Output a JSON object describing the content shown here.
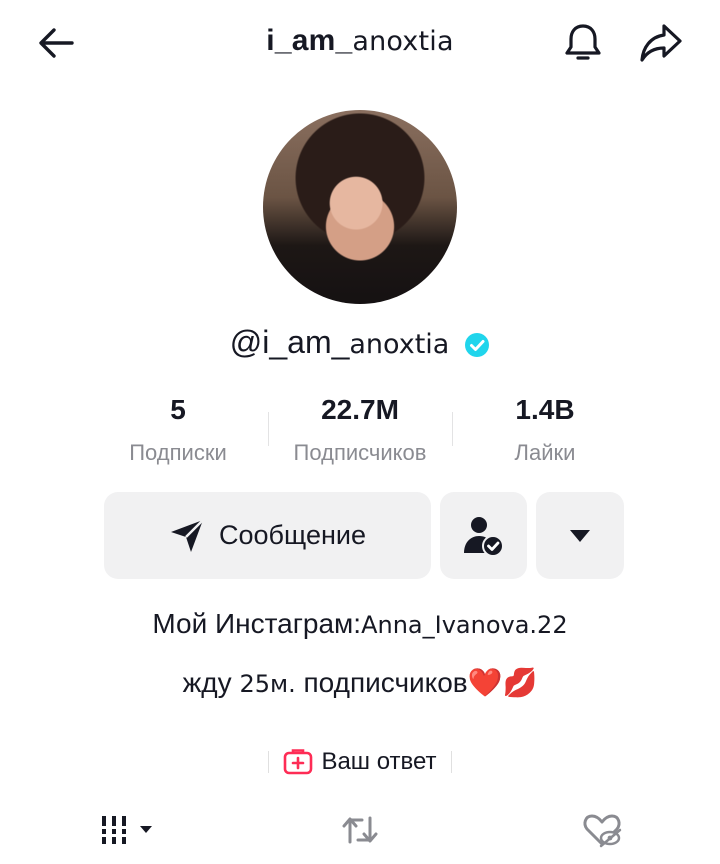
{
  "header": {
    "username_bold": "i_am_",
    "username_thin": "anoxtia"
  },
  "profile": {
    "handle_prefix": "@i_am_",
    "handle_thin": "anoxtia",
    "verified": true
  },
  "stats": [
    {
      "value": "5",
      "label": "Подписки"
    },
    {
      "value": "22.7M",
      "label": "Подписчиков"
    },
    {
      "value": "1.4B",
      "label": "Лайки"
    }
  ],
  "actions": {
    "message_label": "Сообщение"
  },
  "bio": {
    "line1_text": "Мой Инстаграм:",
    "line1_handle": "Anna_Ivanova.22",
    "line2_text": "жду ",
    "line2_thin": "25м.",
    "line2_rest": " подписчиков",
    "line2_emoji": "❤️💋"
  },
  "answer": {
    "label": "Ваш ответ"
  },
  "colors": {
    "verified": "#20d5ec",
    "answer_icon": "#fe2c55",
    "button_bg": "#f1f1f2",
    "muted": "#8a8b91"
  },
  "icons": [
    "back-arrow-icon",
    "bell-icon",
    "share-icon",
    "send-icon",
    "user-check-icon",
    "caret-down-icon",
    "grid-icon",
    "repost-icon",
    "liked-hidden-icon",
    "question-box-icon"
  ]
}
